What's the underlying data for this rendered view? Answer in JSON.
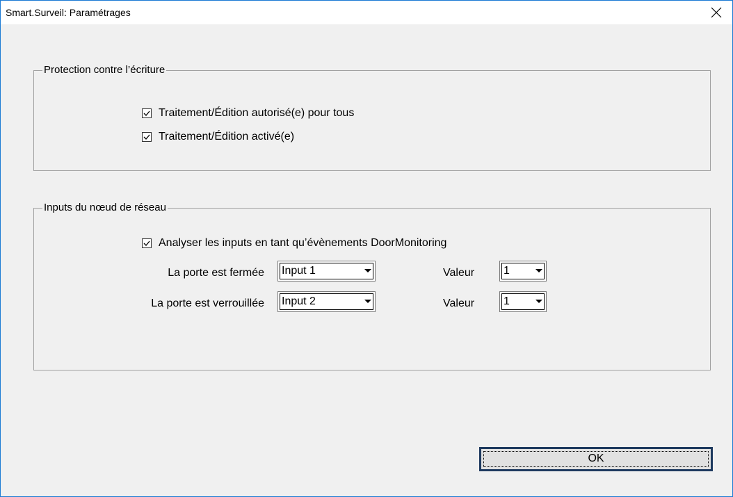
{
  "window": {
    "title": "Smart.Surveil: Paramétrages",
    "close_icon": "close-icon"
  },
  "write_protection": {
    "legend": "Protection contre l’écriture",
    "options": [
      {
        "label": "Traitement/Édition autorisé(e) pour tous",
        "checked": true
      },
      {
        "label": "Traitement/Édition activé(e)",
        "checked": true
      }
    ]
  },
  "network_inputs": {
    "legend": "Inputs du nœud de réseau",
    "analyze": {
      "label": "Analyser les inputs en tant qu’évènements DoorMonitoring",
      "checked": true
    },
    "rows": [
      {
        "label": "La porte est fermée",
        "input_value": "Input 1",
        "valeur_label": "Valeur",
        "valeur_value": "1"
      },
      {
        "label": "La porte est verrouillée",
        "input_value": "Input 2",
        "valeur_label": "Valeur",
        "valeur_value": "1"
      }
    ]
  },
  "buttons": {
    "ok_label": "OK"
  }
}
